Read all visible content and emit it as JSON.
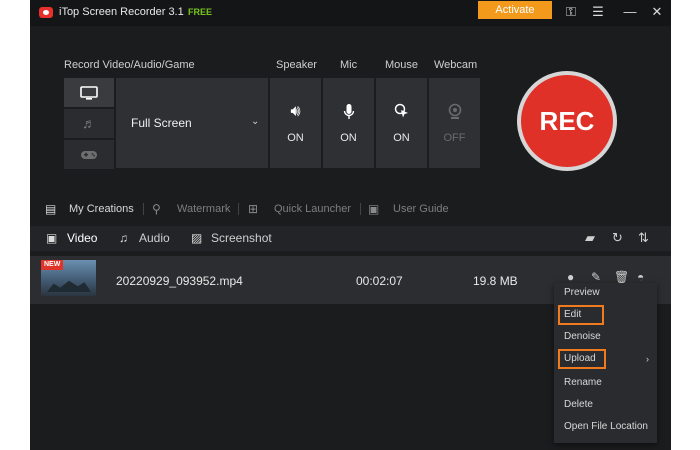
{
  "app": {
    "title": "iTop Screen Recorder 3.1",
    "badge": "FREE",
    "activate_label": "Activate"
  },
  "controls": {
    "record_label": "Record Video/Audio/Game",
    "area_value": "Full Screen",
    "toggles": [
      {
        "label": "Speaker",
        "state": "ON"
      },
      {
        "label": "Mic",
        "state": "ON"
      },
      {
        "label": "Mouse",
        "state": "ON"
      },
      {
        "label": "Webcam",
        "state": "OFF"
      }
    ],
    "rec_label": "REC"
  },
  "links": {
    "my_creations": "My Creations",
    "watermark": "Watermark",
    "quick_launcher": "Quick Launcher",
    "user_guide": "User Guide"
  },
  "media_tabs": {
    "video": "Video",
    "audio": "Audio",
    "screenshot": "Screenshot"
  },
  "files": [
    {
      "new_badge": "NEW",
      "name": "20220929_093952.mp4",
      "duration": "00:02:07",
      "size": "19.8 MB"
    }
  ],
  "context_menu": {
    "preview": "Preview",
    "edit": "Edit",
    "denoise": "Denoise",
    "upload": "Upload",
    "rename": "Rename",
    "delete": "Delete",
    "open_location": "Open File Location"
  },
  "colors": {
    "accent_orange": "#f39a1c",
    "rec_red": "#e03128",
    "free_green": "#78c51e",
    "highlight_border": "#f07a1e",
    "background": "#1b1c1e"
  },
  "icons": {
    "app_logo": "recorder-logo-icon",
    "key": "key-icon",
    "menu": "hamburger-menu-icon",
    "minimize": "minimize-icon",
    "close": "close-icon"
  }
}
